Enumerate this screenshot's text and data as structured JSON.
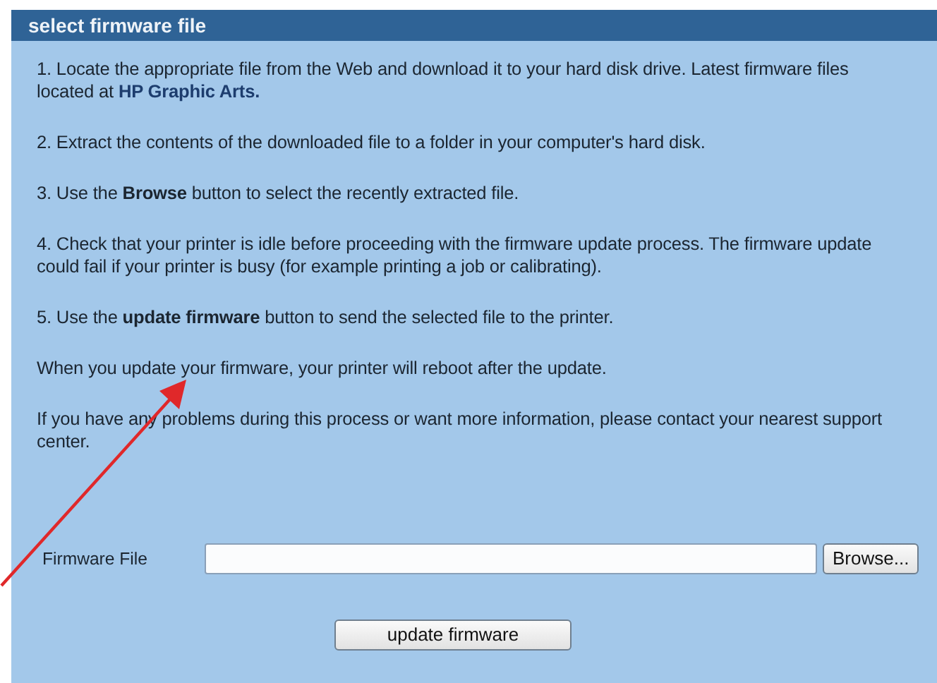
{
  "panel": {
    "title": "select firmware file"
  },
  "paragraphs": [
    {
      "text": "1. Locate the appropriate file from the Web and download it to your hard disk drive. Latest firmware files located at",
      "link": "HP Graphic Arts."
    },
    {
      "text": "2. Extract the contents of the downloaded file to a folder in your computer's hard disk."
    },
    {
      "text": "3. Use the **Browse** button to select the recently extracted file."
    },
    {
      "text": "4. Check that your printer is idle before proceeding with the firmware update process. The firmware update could fail if your printer is busy (for example printing a job or calibrating)."
    },
    {
      "text": "5. Use the **update firmware** button to send the selected file to the printer."
    },
    {
      "text": "When you update your firmware, your printer will reboot after the update."
    },
    {
      "text": "If you have any problems during this process or want more information, please contact your nearest support center."
    }
  ],
  "file_field": {
    "label": "Firmware File",
    "browse_button": "Browse..."
  },
  "submit_button": "update firmware"
}
